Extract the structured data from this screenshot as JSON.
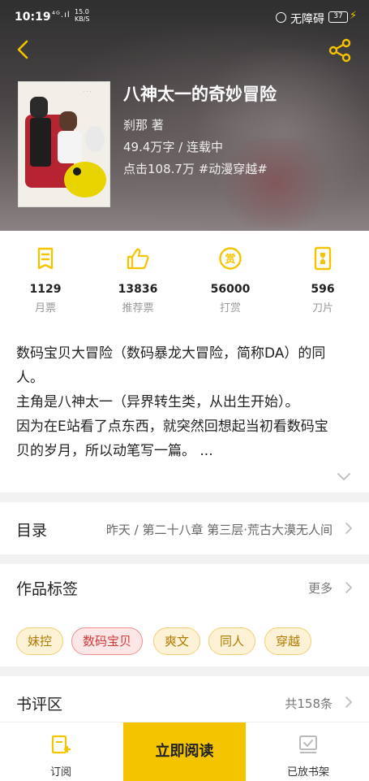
{
  "status_bar": {
    "time": "10:19",
    "signal": "⁴ᴳ.ıl",
    "speed_value": "15.0",
    "speed_unit": "KB/S",
    "accessibility": "无障碍",
    "battery": "37"
  },
  "book": {
    "title": "八神太一的奇妙冒险",
    "author": "刹那 著",
    "words_status": "49.4万字 / 连载中",
    "clicks_tag": "点击108.7万 #动漫穿越#"
  },
  "stats": [
    {
      "icon": "monthly-ticket-icon",
      "value": "1129",
      "label": "月票"
    },
    {
      "icon": "thumbs-up-icon",
      "value": "13836",
      "label": "推荐票"
    },
    {
      "icon": "reward-coin-icon",
      "value": "56000",
      "label": "打赏"
    },
    {
      "icon": "blade-icon",
      "value": "596",
      "label": "刀片"
    }
  ],
  "description": {
    "line1": "数码宝贝大冒险（数码暴龙大冒险，简称DA）的同人。",
    "line2": "主角是八神太一（异界转生类，从出生开始）。",
    "line3": "因为在E站看了点东西，就突然回想起当初看数码宝贝的岁月，所以动笔写一篇。 ..."
  },
  "toc": {
    "label": "目录",
    "latest": "昨天 / 第二十八章 第三层·荒古大漠无人间"
  },
  "tags_section": {
    "label": "作品标签",
    "more": "更多",
    "tags": [
      "妹控",
      "数码宝贝",
      "爽文",
      "同人",
      "穿越"
    ]
  },
  "reviews": {
    "label": "书评区",
    "count": "共158条"
  },
  "bottom_bar": {
    "subscribe": "订阅",
    "read_now": "立即阅读",
    "added_shelf": "已放书架"
  },
  "colors": {
    "accent": "#f5c400",
    "tag_yellow": "#f1cf75",
    "tag_red": "#ef8f8f"
  }
}
